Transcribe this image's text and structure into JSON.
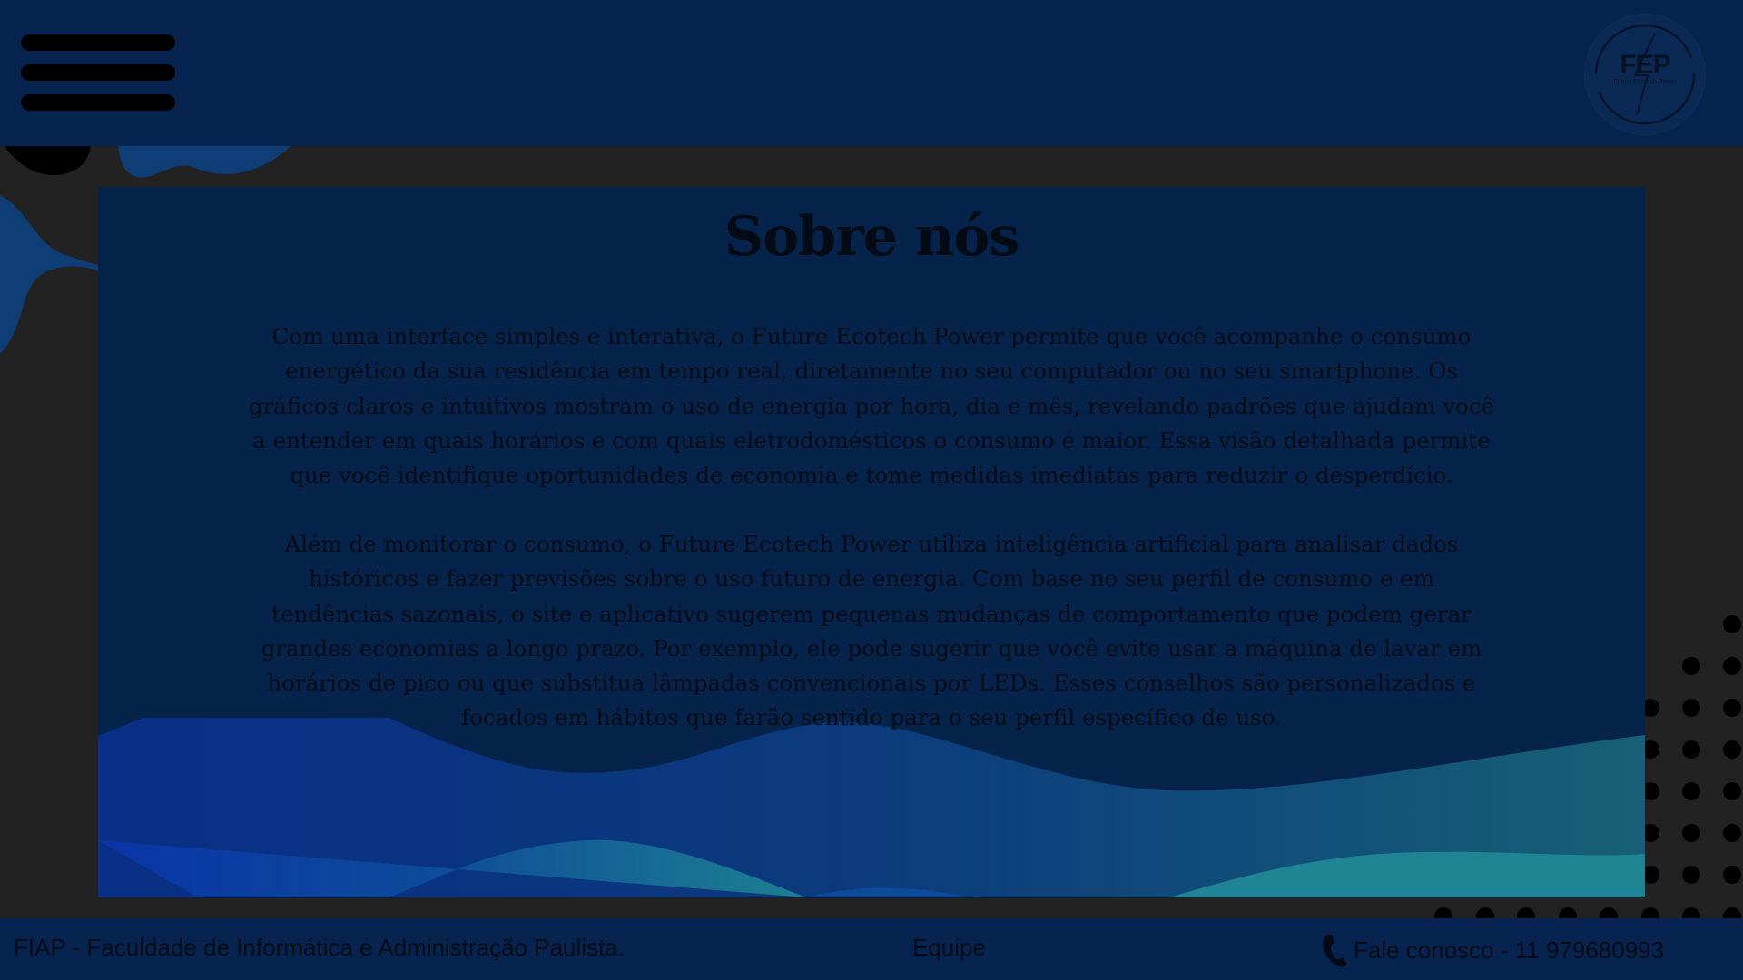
{
  "header": {
    "menu_icon": "hamburger-menu-icon",
    "logo": {
      "text": "FEP",
      "subtext": "Future Ecotech Power"
    }
  },
  "main": {
    "title": "Sobre nós",
    "paragraphs": [
      "Com uma interface simples e interativa, o Future Ecotech Power permite que você acompanhe o consumo energético da sua residência em tempo real, diretamente no seu computador ou no seu smartphone. Os gráficos claros e intuitivos mostram o uso de energia por hora, dia e mês, revelando padrões que ajudam você a entender em quais horários e com quais eletrodomésticos o consumo é maior. Essa visão detalhada permite que você identifique oportunidades de economia e tome medidas imediatas para reduzir o desperdício.",
      "Além de monitorar o consumo, o Future Ecotech Power utiliza inteligência artificial para analisar dados históricos e fazer previsões sobre o uso futuro de energia. Com base no seu perfil de consumo e em tendências sazonais, o site e aplicativo sugerem pequenas mudanças de comportamento que podem gerar grandes economias a longo prazo. Por exemplo, ele pode sugerir que você evite usar a máquina de lavar em horários de pico ou que substitua lâmpadas convencionais por LEDs. Esses conselhos são personalizados e focados em hábitos que farão sentido para o seu perfil específico de uso."
    ]
  },
  "footer": {
    "institution": "FIAP - Faculdade de Informática e Administração Paulista.",
    "team_link": "Equipe",
    "contact": "Fale conosco - 11 979680993",
    "contact_icon": "phone-icon"
  },
  "colors": {
    "header_bg": "#06244f",
    "page_bg": "#222222",
    "card_bg": "#06234c",
    "text": "#050b14"
  }
}
